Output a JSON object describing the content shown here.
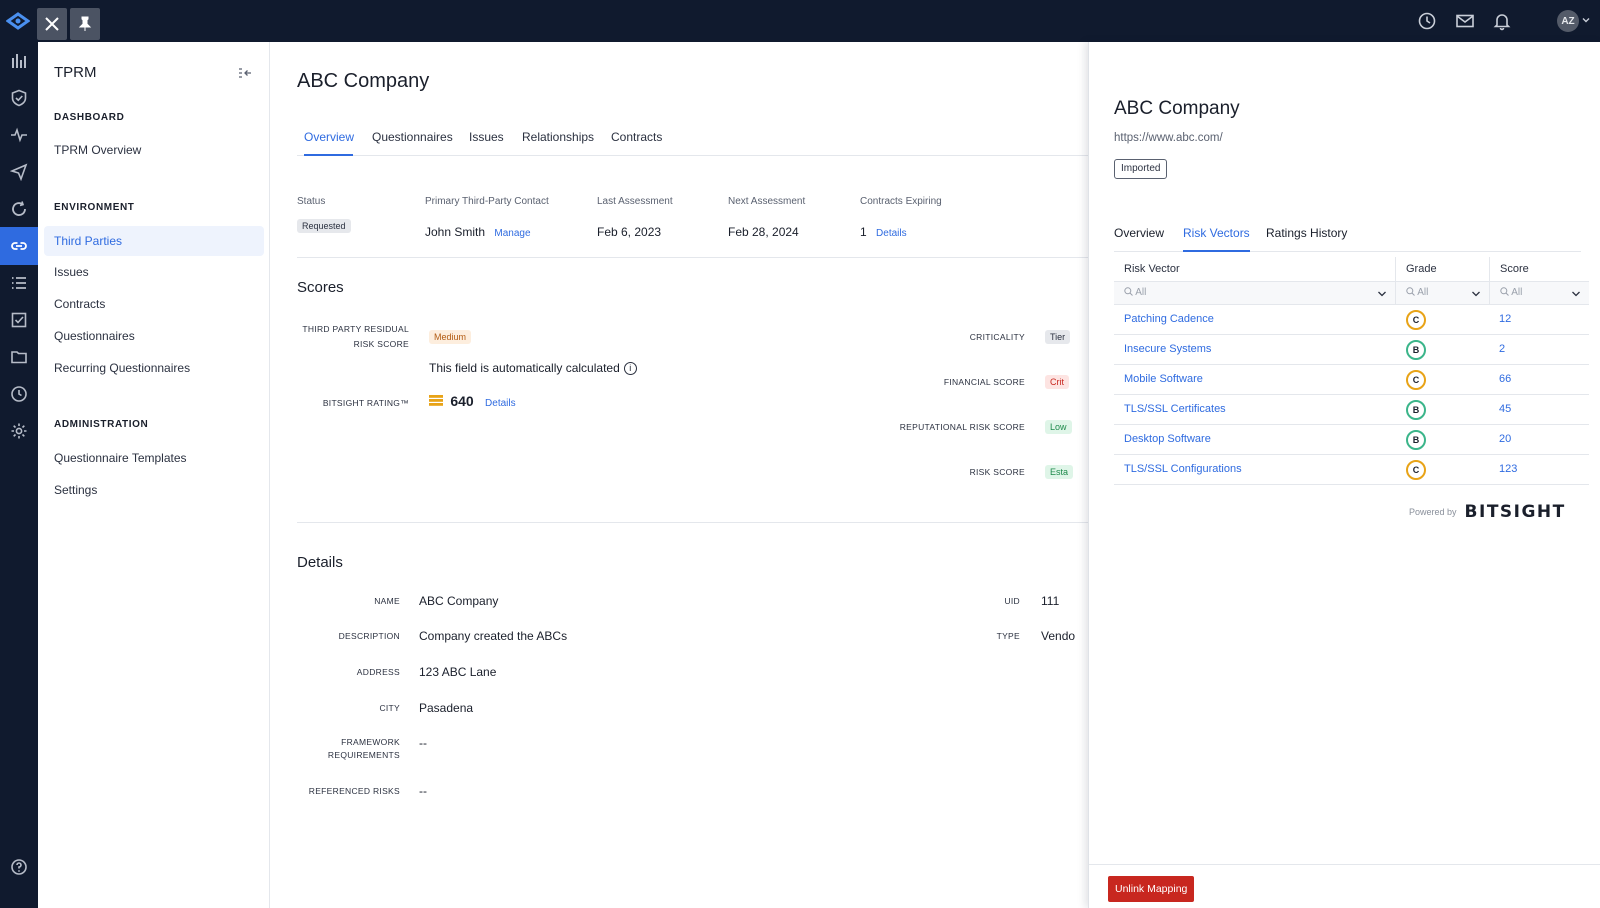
{
  "topbar": {
    "icons": [
      "logo-icon",
      "close-icon",
      "pin-icon",
      "history-icon",
      "mail-icon",
      "bell-icon"
    ],
    "avatar_initials": "AZ",
    "colors": {
      "bar": "#101a2e",
      "accent": "#2f6be0"
    }
  },
  "rail": {
    "items": [
      "dashboard-icon",
      "shield-icon",
      "activity-icon",
      "send-icon",
      "refresh-icon",
      "link-icon",
      "list-icon",
      "checklist-icon",
      "folder-icon",
      "clock-icon",
      "gear-icon",
      "help-icon"
    ],
    "active": "link-icon"
  },
  "sidenav": {
    "title": "TPRM",
    "sections": {
      "dashboard": "DASHBOARD",
      "environment": "ENVIRONMENT",
      "administration": "ADMINISTRATION"
    },
    "links": {
      "tprm_overview": "TPRM Overview",
      "third_parties": "Third Parties",
      "issues": "Issues",
      "contracts": "Contracts",
      "questionnaires": "Questionnaires",
      "recurring_questionnaires": "Recurring Questionnaires",
      "questionnaire_templates": "Questionnaire Templates",
      "settings": "Settings"
    }
  },
  "main": {
    "title": "ABC Company",
    "tabs": [
      "Overview",
      "Questionnaires",
      "Issues",
      "Relationships",
      "Contracts"
    ],
    "meta": {
      "status_label": "Status",
      "status_value": "Requested",
      "contact_label": "Primary Third-Party Contact",
      "contact_value": "John Smith",
      "contact_link": "Manage",
      "last_label": "Last Assessment",
      "last_value": "Feb 6, 2023",
      "next_label": "Next Assessment",
      "next_value": "Feb 28, 2024",
      "contracts_label": "Contracts Expiring",
      "contracts_value": "1",
      "contracts_link": "Details"
    },
    "scores": {
      "title": "Scores",
      "residual_label_1": "THIRD PARTY RESIDUAL",
      "residual_label_2": "RISK SCORE",
      "residual_value": "Medium",
      "auto_calc": "This field is automatically calculated",
      "bitsight_label": "BITSIGHT RATING™",
      "bitsight_value": "640",
      "bitsight_link": "Details",
      "criticality_label": "CRITICALITY",
      "criticality_value": "Tier",
      "financial_label": "FINANCIAL SCORE",
      "financial_value": "Crit",
      "reputational_label": "REPUTATIONAL RISK SCORE",
      "reputational_value": "Low",
      "risk_label": "RISK SCORE",
      "risk_value": "Esta"
    },
    "details": {
      "title": "Details",
      "name_label": "NAME",
      "name_value": "ABC Company",
      "description_label": "DESCRIPTION",
      "description_value": "Company created the ABCs",
      "address_label": "ADDRESS",
      "address_value": "123 ABC Lane",
      "city_label": "CITY",
      "city_value": "Pasadena",
      "framework_label_1": "FRAMEWORK",
      "framework_label_2": "REQUIREMENTS",
      "framework_value": "--",
      "referenced_label": "REFERENCED RISKS",
      "referenced_value": "--",
      "uid_label": "UID",
      "uid_value": "111",
      "type_label": "TYPE",
      "type_value": "Vendo"
    }
  },
  "panel": {
    "title": "ABC Company",
    "url": "https://www.abc.com/",
    "badge": "Imported",
    "tabs": [
      "Overview",
      "Risk Vectors",
      "Ratings History"
    ],
    "grid": {
      "headers": [
        "Risk Vector",
        "Grade",
        "Score"
      ],
      "filter_placeholder": "All",
      "rows": [
        {
          "vector": "Patching Cadence",
          "grade": "C",
          "score": "12"
        },
        {
          "vector": "Insecure Systems",
          "grade": "B",
          "score": "2"
        },
        {
          "vector": "Mobile Software",
          "grade": "C",
          "score": "66"
        },
        {
          "vector": "TLS/SSL Certificates",
          "grade": "B",
          "score": "45"
        },
        {
          "vector": "Desktop Software",
          "grade": "B",
          "score": "20"
        },
        {
          "vector": "TLS/SSL Configurations",
          "grade": "C",
          "score": "123"
        }
      ],
      "grade_colors": {
        "B": "#3bb58a",
        "C": "#e8a317"
      }
    },
    "powered_by": "Powered by",
    "brand": "BITSIGHT",
    "unlink_button": "Unlink Mapping"
  }
}
